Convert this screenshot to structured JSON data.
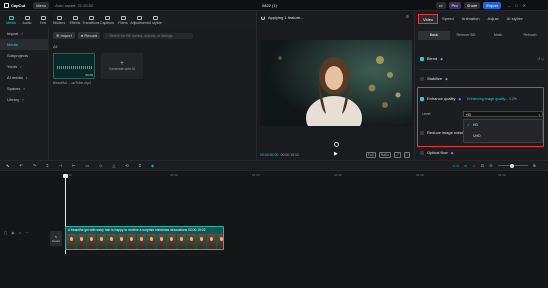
{
  "titlebar": {
    "app_name": "CapCut",
    "menu_label": "Menu",
    "autosave": "Auto saved: 21:10:52",
    "doc_title": "0822 (1)",
    "pro_label": "Pro",
    "share_label": "Share",
    "export_label": "Export"
  },
  "media_tools": [
    {
      "label": "Media",
      "active": true
    },
    {
      "label": "Audio"
    },
    {
      "label": "Text"
    },
    {
      "label": "Stickers"
    },
    {
      "label": "Effects"
    },
    {
      "label": "Transitions"
    },
    {
      "label": "Captions"
    },
    {
      "label": "Filters"
    },
    {
      "label": "Adjustment"
    },
    {
      "label": "AI stylize"
    }
  ],
  "left_nav": [
    {
      "label": "Import",
      "active": false
    },
    {
      "label": "Media",
      "active": true
    },
    {
      "label": "Subprojects"
    },
    {
      "label": "Yours"
    },
    {
      "label": "AI media"
    },
    {
      "label": "Spaces"
    },
    {
      "label": "Library"
    }
  ],
  "media": {
    "import_label": "Import",
    "record_label": "Record",
    "search_placeholder": "Search for file names, scenes, or dialogs",
    "filter_label": "All",
    "thumb_name": "Beautiful ... ouTube.mp4",
    "thumb_duration": "00:09",
    "gen_card_label": "Generate with AI"
  },
  "player": {
    "status": "Applying 1 feature...",
    "timecode_current": "00:00:00:00",
    "timecode_total": "00:00:19:02",
    "controls": [
      "Full",
      "Ratio",
      "⤢",
      "⛶"
    ]
  },
  "inspector": {
    "tabs": [
      {
        "label": "Video",
        "active": true
      },
      {
        "label": "Speed"
      },
      {
        "label": "Animation"
      },
      {
        "label": "Adjust"
      },
      {
        "label": "AI stylize"
      }
    ],
    "subtabs": [
      {
        "label": "Basic",
        "active": true
      },
      {
        "label": "Remove BG"
      },
      {
        "label": "Mask"
      },
      {
        "label": "Retouch"
      }
    ],
    "blend_label": "Blend",
    "stabilize_label": "Stabilize",
    "enhance_label": "Enhance quality",
    "enhance_status": "Enhancing image quality... 0.2%",
    "level_label": "Level",
    "level_value": "HD",
    "level_options": [
      {
        "label": "HD",
        "selected": true
      },
      {
        "label": "UHD",
        "selected": false
      }
    ],
    "reduce_noise_label": "Reduce image noise",
    "optical_flow_label": "Optical flow",
    "highlight_color": "#e23a3a",
    "accent_color": "#23d0cf"
  },
  "timeline": {
    "ruler": [
      "00:00",
      "00:30",
      "01:00",
      "01:30",
      "02:00",
      "02:30",
      "03:00",
      "03:30"
    ],
    "cover_label": "Cover",
    "clip_label": "A beautiful girl with wavy hair is happy to receive a surprise christmas decorations  00:00:19:02",
    "clip_frames": 16
  }
}
